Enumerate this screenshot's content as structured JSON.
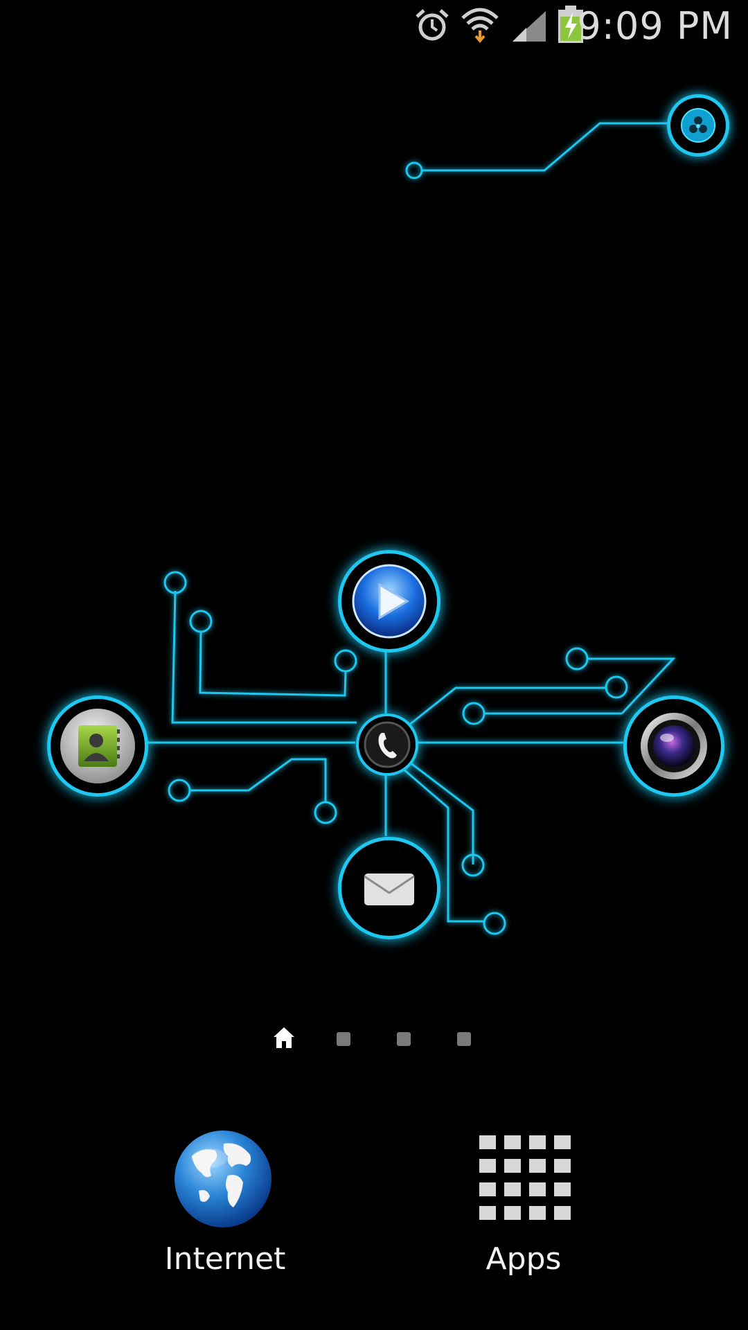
{
  "status_bar": {
    "time": "9:09 PM",
    "icons": [
      "alarm-icon",
      "wifi-icon",
      "signal-icon",
      "battery-charging-icon"
    ]
  },
  "widget": {
    "nodes": [
      "biohazard-icon",
      "video-play-icon",
      "contacts-icon",
      "phone-icon",
      "camera-icon",
      "email-icon"
    ]
  },
  "page_indicator": {
    "pages": 4,
    "current": 1,
    "home_icon": "home-icon"
  },
  "dock": {
    "internet_label": "Internet",
    "apps_label": "Apps",
    "internet_icon": "globe-icon",
    "apps_icon": "apps-grid-icon"
  },
  "colors": {
    "accent": "#1ec8f0",
    "background": "#000000",
    "text": "#f2f2f2"
  }
}
